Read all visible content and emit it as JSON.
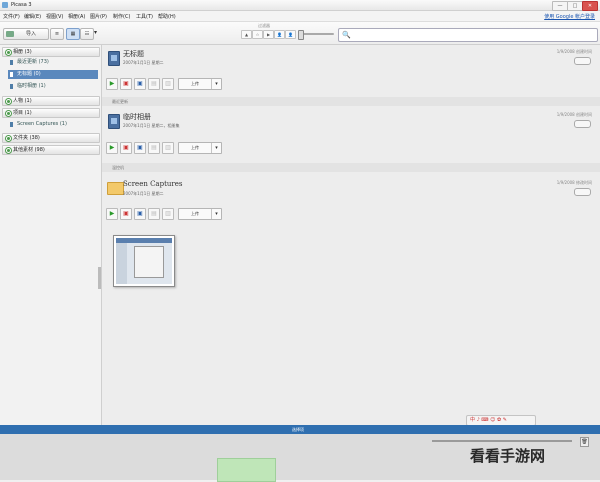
{
  "window": {
    "title": "Picasa 3",
    "min_label": "—",
    "max_label": "□",
    "close_label": "✕"
  },
  "menu": {
    "items": [
      "文件(F)",
      "编辑(E)",
      "视图(V)",
      "相册(A)",
      "图片(P)",
      "制作(C)",
      "工具(T)",
      "帮助(H)"
    ],
    "sign_in": "使用 Google 帐户登录"
  },
  "toolbar": {
    "import_label": "导入",
    "view_drop": "▾",
    "filter_label": "过滤器",
    "filter_buttons": [
      "▲",
      "☆",
      "▶",
      "👤",
      "👤",
      "⚑"
    ],
    "search_placeholder": "",
    "search_icon": "🔍"
  },
  "sidebar": {
    "groups": [
      {
        "label": "相册 (3)"
      },
      {
        "label": "人物 (1)"
      },
      {
        "label": "项目 (1)"
      },
      {
        "label": "文件夹 (38)"
      },
      {
        "label": "其他素材 (98)"
      }
    ],
    "album_items": [
      {
        "label": "最近更新 (73)",
        "selected": false
      },
      {
        "label": "无标题 (0)",
        "selected": true
      },
      {
        "label": "临时相册 (1)",
        "selected": false
      }
    ],
    "project_items": [
      {
        "label": "Screen Captures (1)"
      }
    ]
  },
  "main": {
    "albums": [
      {
        "header": "",
        "title": "无标题",
        "subtitle": "2007年1月1日 星期二",
        "meta": "1/9/2008 创建时间",
        "dropdown": "上传"
      },
      {
        "header": "最近更新",
        "title": "临时相册",
        "subtitle": "2007年1月1日 星期二，相册集",
        "meta": "1/9/2008 创建时间",
        "dropdown": "上传"
      },
      {
        "header": "温控机",
        "title": "Screen Captures",
        "subtitle": "2007年1月1日 星期二",
        "meta": "1/9/2008 修改时间",
        "dropdown": "上传"
      }
    ],
    "controls": {
      "play": "▶",
      "collage": "▣",
      "movie": "▣",
      "blog": "▤",
      "share": "▥",
      "dropdown_arrow": "▾"
    }
  },
  "tray": {
    "title": "选择项",
    "button": "🗑"
  },
  "ime": {
    "label": "中 ♪ ⌨ ☺ ✿ ✎"
  },
  "watermark": {
    "text": "看看手游网"
  }
}
